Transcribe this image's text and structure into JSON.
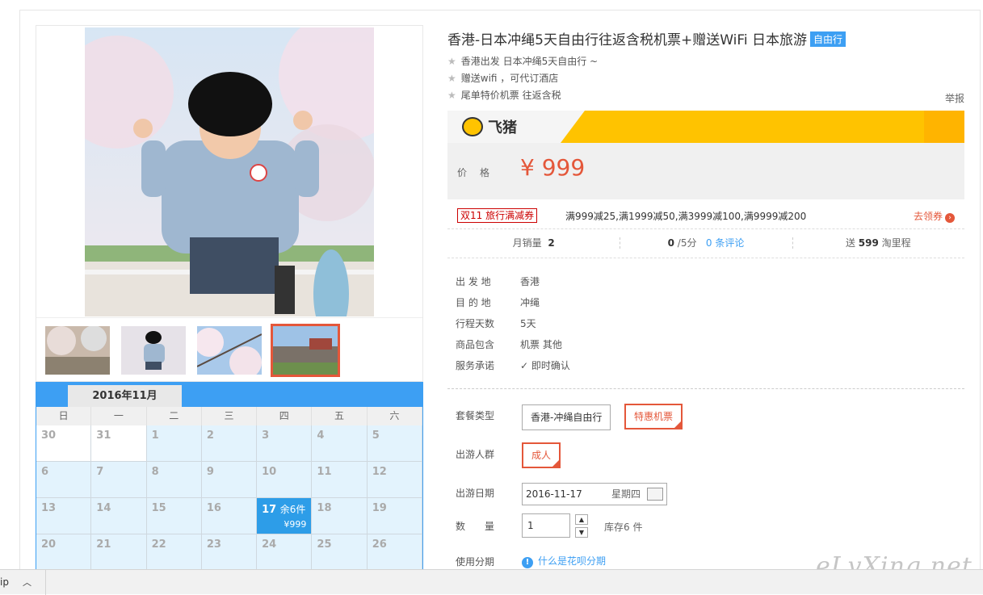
{
  "product": {
    "title": "香港-日本冲绳5天自由行往返含税机票+赠送WiFi 日本旅游",
    "badge": "自由行",
    "features": [
      "香港出发 日本冲绳5天自由行 ~",
      "赠送wifi ，可代订酒店",
      "尾单特价机票 往返含税"
    ],
    "report": "举报"
  },
  "banner": {
    "brand": "飞猪"
  },
  "price": {
    "label": "价格",
    "value": "¥ 999"
  },
  "promo": {
    "tag": "双11 旅行满减券",
    "text": "满999减25,满1999减50,满3999减100,满9999减200",
    "action": "去领券"
  },
  "stats": {
    "monthly_label": "月销量",
    "monthly_value": "2",
    "score_value": "0",
    "score_suffix": "/5分",
    "reviews": "0 条评论",
    "miles_prefix": "送",
    "miles_value": "599",
    "miles_suffix": "淘里程"
  },
  "info": [
    {
      "k": "出 发 地",
      "v": "香港"
    },
    {
      "k": "目 的 地",
      "v": "冲绳"
    },
    {
      "k": "行程天数",
      "v": "5天"
    },
    {
      "k": "商品包含",
      "v": "机票  其他"
    },
    {
      "k": "服务承诺",
      "v": "即时确认"
    }
  ],
  "options": {
    "package_label": "套餐类型",
    "package_opts": [
      "香港-冲绳自由行",
      "特惠机票"
    ],
    "group_label": "出游人群",
    "group_opts": [
      "成人"
    ],
    "date_label": "出游日期",
    "date_value": "2016-11-17",
    "date_weekday": "星期四",
    "qty_label": "数　　量",
    "qty_value": "1",
    "stock": "库存6 件",
    "installment_label": "使用分期",
    "installment_link": "什么是花呗分期"
  },
  "calendar": {
    "month": "2016年11月",
    "weekdays": [
      "日",
      "一",
      "二",
      "三",
      "四",
      "五",
      "六"
    ],
    "selected": {
      "day": "17",
      "remain": "余6件",
      "price": "¥999"
    }
  },
  "watermark": "eLvXing.net",
  "download_bar": {
    "label": "ip"
  },
  "colors": {
    "accent": "#e4573a",
    "blue": "#3d9ff3",
    "yellow": "#ffc300"
  }
}
